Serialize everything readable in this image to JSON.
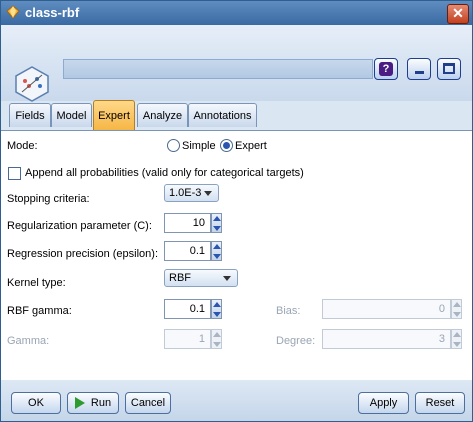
{
  "window": {
    "title": "class-rbf",
    "close_icon": "close-icon",
    "app_icon": "diamond-icon"
  },
  "header": {
    "node_icon": "svm-node-icon",
    "name_value": "",
    "help_label": "?"
  },
  "tabs": [
    {
      "label": "Fields"
    },
    {
      "label": "Model"
    },
    {
      "label": "Expert",
      "active": true
    },
    {
      "label": "Analyze"
    },
    {
      "label": "Annotations"
    }
  ],
  "form": {
    "mode_label": "Mode:",
    "mode_options": [
      "Simple",
      "Expert"
    ],
    "mode_selected": "Expert",
    "append_prob_label": "Append all probabilities (valid only for categorical targets)",
    "append_prob_checked": false,
    "stopping_label": "Stopping criteria:",
    "stopping_value": "1.0E-3",
    "regularization_label": "Regularization parameter (C):",
    "regularization_value": "10",
    "regression_label": "Regression precision (epsilon):",
    "regression_value": "0.1",
    "kernel_label": "Kernel type:",
    "kernel_value": "RBF",
    "rbf_gamma_label": "RBF gamma:",
    "rbf_gamma_value": "0.1",
    "bias_label": "Bias:",
    "bias_value": "0",
    "gamma_label": "Gamma:",
    "gamma_value": "1",
    "degree_label": "Degree:",
    "degree_value": "3"
  },
  "footer": {
    "ok": "OK",
    "run": "Run",
    "cancel": "Cancel",
    "apply": "Apply",
    "reset": "Reset"
  },
  "colors": {
    "accent": "#f6b646",
    "titlebar": "#3a6aa3",
    "background": "#dbe6f3"
  }
}
